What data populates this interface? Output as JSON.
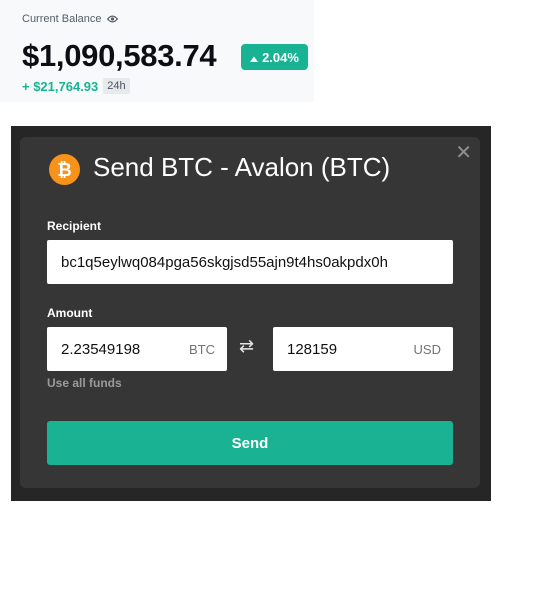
{
  "balance": {
    "label": "Current Balance",
    "amount": "$1,090,583.74",
    "percent_change": "2.04%",
    "change_amount": "+ $21,764.93",
    "period": "24h"
  },
  "modal": {
    "title": "Send BTC - Avalon (BTC)",
    "recipient_label": "Recipient",
    "recipient_value": "bc1q5eylwq084pga56skgjsd55ajn9t4hs0akpdx0h",
    "amount_label": "Amount",
    "btc_amount": "2.23549198",
    "btc_unit": "BTC",
    "usd_amount": "128159",
    "usd_unit": "USD",
    "use_all_funds": "Use all funds",
    "send_label": "Send",
    "close_symbol": "✕"
  },
  "colors": {
    "accent": "#19b394",
    "bitcoin": "#f7931a",
    "overlay": "#262626",
    "modal_bg": "#363636"
  },
  "icons": {
    "balance_visibility": "eye-icon",
    "trend": "caret-up-icon",
    "coin": "bitcoin-icon",
    "swap": "swap-arrows-icon",
    "close": "close-icon"
  }
}
